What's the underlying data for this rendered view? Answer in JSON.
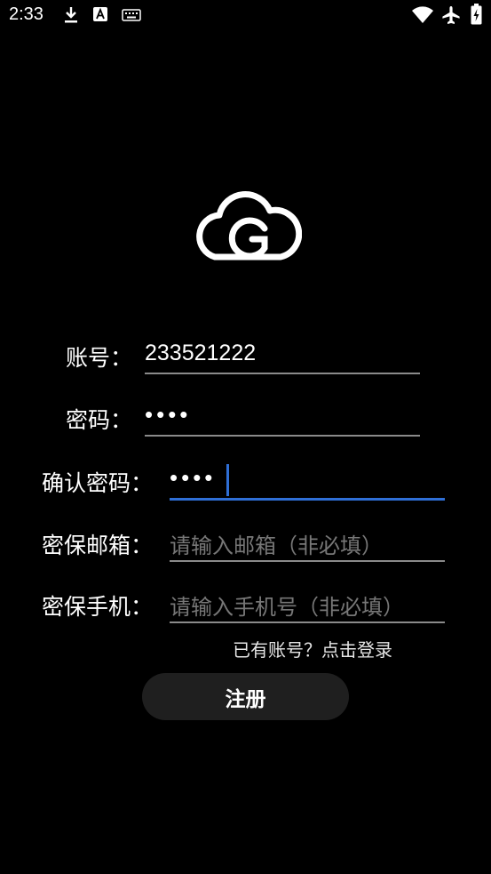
{
  "status_bar": {
    "time": "2:33"
  },
  "form": {
    "account": {
      "label": "账号：",
      "value": "233521222"
    },
    "password": {
      "label": "密码：",
      "value": "••••"
    },
    "confirm_password": {
      "label": "确认密码：",
      "value": "••••"
    },
    "email": {
      "label": "密保邮箱：",
      "placeholder": "请输入邮箱（非必填）"
    },
    "phone": {
      "label": "密保手机：",
      "placeholder": "请输入手机号（非必填）"
    }
  },
  "login_link": "已有账号？点击登录",
  "register_button": "注册",
  "colors": {
    "background": "#000000",
    "accent": "#2f6fd6",
    "button_bg": "#1f1f1f"
  }
}
